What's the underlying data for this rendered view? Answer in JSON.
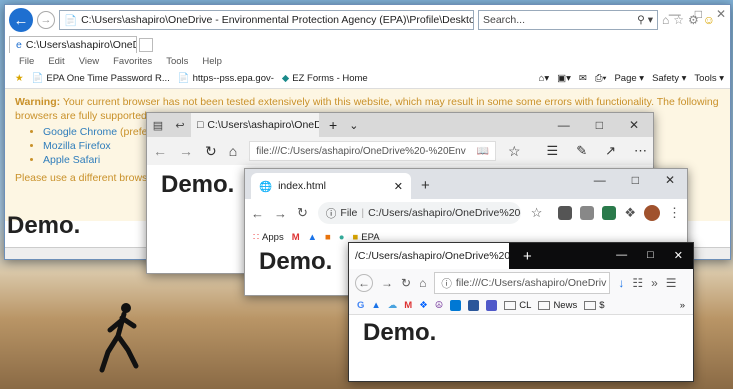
{
  "ie": {
    "address": "C:\\Users\\ashapiro\\OneDrive - Environmental Protection Agency (EPA)\\Profile\\Desktop\\index.html",
    "search_placeholder": "Search...",
    "tab_title": "C:\\Users\\ashapiro\\OneDriv...",
    "menu": [
      "File",
      "Edit",
      "View",
      "Favorites",
      "Tools",
      "Help"
    ],
    "favorites": [
      "EPA One Time Password R...",
      "https--pss.epa.gov-",
      "EZ Forms - Home"
    ],
    "commands": [
      "Page ▾",
      "Safety ▾",
      "Tools ▾"
    ],
    "warning_label": "Warning:",
    "warning_text": " Your current browser has not been tested extensively with this website, which may result in some some errors with functionality. The following browsers are fully supported:",
    "browsers": [
      {
        "name": "Google Chrome",
        "note": " (preferred)"
      },
      {
        "name": "Mozilla Firefox",
        "note": ""
      },
      {
        "name": "Apple Safari",
        "note": ""
      }
    ],
    "advice": "Please use a different browser fo",
    "demo": "Demo."
  },
  "edge": {
    "tab_title": "C:\\Users\\ashapiro\\OneD",
    "url": "file:///C:/Users/ashapiro/OneDrive%20-%20Env",
    "demo": "Demo."
  },
  "chrome": {
    "tab_title": "index.html",
    "file_label": "File",
    "url": "C:/Users/ashapiro/OneDrive%20-%20Envir...",
    "bookmarks": [
      "Apps",
      "EPA"
    ],
    "demo": "Demo."
  },
  "firefox": {
    "tab_title": "/C:/Users/ashapiro/OneDrive%20-%",
    "url": "file:///C:/Users/ashapiro/OneDriv",
    "bookmarks": [
      "CL",
      "News",
      "$"
    ],
    "demo": "Demo."
  },
  "colors": {
    "ie_accent": "#1e6fd0",
    "warning_bg": "#fdf6e3",
    "warning_text": "#c9912a",
    "link": "#2f7dbb",
    "firefox_tabbar": "#0c0c0d"
  }
}
